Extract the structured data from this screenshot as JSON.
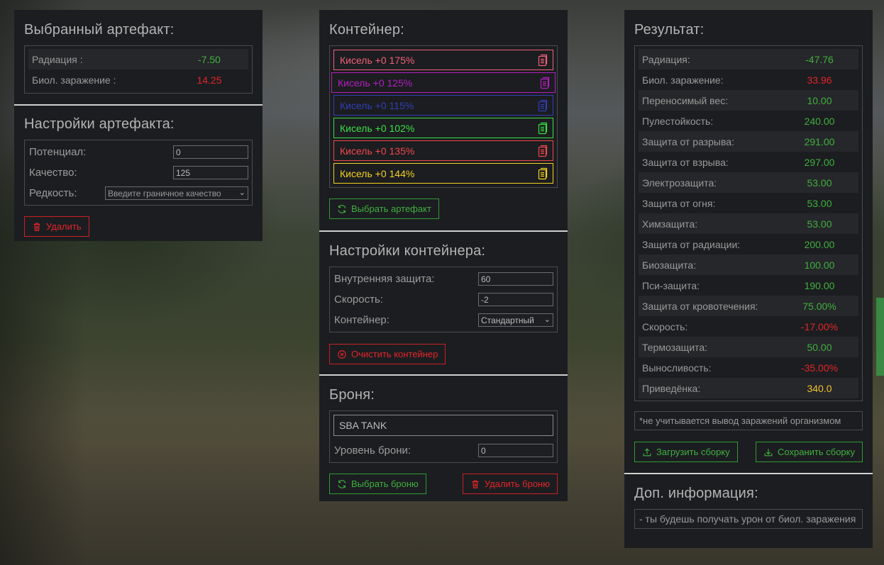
{
  "colors": {
    "panel": "#1c1d20",
    "green": "#3fb040",
    "red": "#e2252a",
    "yellow": "#f1c232"
  },
  "artifact": {
    "title": "Выбранный артефакт:",
    "stats": [
      {
        "label": "Радиация :",
        "value": "-7.50",
        "color": "green"
      },
      {
        "label": "Биол. заражение :",
        "value": "14.25",
        "color": "red"
      }
    ],
    "settings_title": "Настройки артефакта:",
    "potential_label": "Потенциал:",
    "potential_value": "0",
    "quality_label": "Качество:",
    "quality_value": "125",
    "rarity_label": "Редкость:",
    "rarity_placeholder": "Введите граничное качество",
    "delete_label": "Удалить"
  },
  "container": {
    "title": "Контейнер:",
    "slots": [
      {
        "label": "Кисель +0 175%",
        "color": "#f0607a"
      },
      {
        "label": "Кисель +0 125%",
        "color": "#b21ec0"
      },
      {
        "label": "Кисель +0 115%",
        "color": "#2f3fb8"
      },
      {
        "label": "Кисель +0 102%",
        "color": "#39e045"
      },
      {
        "label": "Кисель +0 135%",
        "color": "#f0484e"
      },
      {
        "label": "Кисель +0 144%",
        "color": "#f1d21e"
      }
    ],
    "choose_label": "Выбрать артефакт",
    "settings_title": "Настройки контейнера:",
    "inner_label": "Внутренняя защита:",
    "inner_value": "60",
    "speed_label": "Скорость:",
    "speed_value": "-2",
    "type_label": "Контейнер:",
    "type_value": "Стандартный",
    "clear_label": "Очистить контейнер"
  },
  "armor": {
    "title": "Броня:",
    "name": "SBA TANK",
    "level_label": "Уровень брони:",
    "level_value": "0",
    "choose_label": "Выбрать броню",
    "delete_label": "Удалить броню"
  },
  "result": {
    "title": "Результат:",
    "stats": [
      {
        "label": "Радиация:",
        "value": "-47.76",
        "color": "green"
      },
      {
        "label": "Биол. заражение:",
        "value": "33.96",
        "color": "red"
      },
      {
        "label": "Переносимый вес:",
        "value": "10.00",
        "color": "green"
      },
      {
        "label": "Пулестойкость:",
        "value": "240.00",
        "color": "green"
      },
      {
        "label": "Защита от разрыва:",
        "value": "291.00",
        "color": "green"
      },
      {
        "label": "Защита от взрыва:",
        "value": "297.00",
        "color": "green"
      },
      {
        "label": "Электрозащита:",
        "value": "53.00",
        "color": "green"
      },
      {
        "label": "Защита от огня:",
        "value": "53.00",
        "color": "green"
      },
      {
        "label": "Химзащита:",
        "value": "53.00",
        "color": "green"
      },
      {
        "label": "Защита от радиации:",
        "value": "200.00",
        "color": "green"
      },
      {
        "label": "Биозащита:",
        "value": "100.00",
        "color": "green"
      },
      {
        "label": "Пси-защита:",
        "value": "190.00",
        "color": "green"
      },
      {
        "label": "Защита от кровотечения:",
        "value": "75.00%",
        "color": "green"
      },
      {
        "label": "Скорость:",
        "value": "-17.00%",
        "color": "red"
      },
      {
        "label": "Термозащита:",
        "value": "50.00",
        "color": "green"
      },
      {
        "label": "Выносливость:",
        "value": "-35.00%",
        "color": "red"
      },
      {
        "label": "Приведёнка:",
        "value": "340.0",
        "color": "yellow"
      }
    ],
    "note": "*не учитывается вывод заражений организмом",
    "load_label": "Загрузить сборку",
    "save_label": "Сохранить сборку",
    "extra_title": "Доп. информация:",
    "extra_text": "- ты будешь получать урон от биол. заражения"
  }
}
